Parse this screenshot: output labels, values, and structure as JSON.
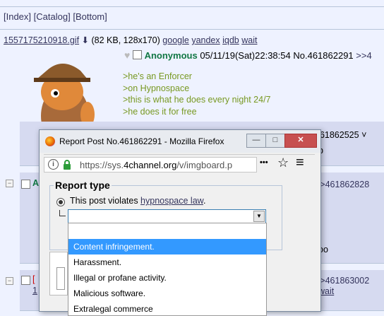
{
  "nav": {
    "index": "[Index]",
    "catalog": "[Catalog]",
    "bottom": "[Bottom]"
  },
  "file": {
    "filename": "1557175210918.gif",
    "meta": "(82 KB, 128x170)",
    "search_links": [
      "google",
      "yandex",
      "iqdb",
      "wait"
    ]
  },
  "post": {
    "name": "Anonymous",
    "datetime": "05/11/19(Sat)22:38:54",
    "number": "No.461862291",
    "arrows": ">>4",
    "lines": [
      ">he's an Enforcer",
      ">on Hypnospace",
      ">this is what he does every night 24/7",
      ">he does it for free"
    ]
  },
  "side": {
    "reply1_no": "461862525",
    "reply1_chev": "˅",
    "reply2_no": ">>461862828",
    "reply2_letter": "A",
    "reply3_no": ">>461863002",
    "reply3_link": "wait",
    "reply3_num": "1",
    "frag_oo": "oo",
    "frag_b": "b",
    "frag_bracket": "["
  },
  "window": {
    "title": "Report Post No.461862291 - Mozilla Firefox",
    "url_prefix": "https://sys.",
    "url_domain": "4channel.org",
    "url_suffix": "/v/imgboard.p",
    "more_icon": "•••",
    "star_icon": "☆",
    "menu_icon": "≡"
  },
  "report": {
    "legend": "Report type",
    "violates_prefix": "This post violates ",
    "violates_link": "hypnospace law",
    "violates_suffix": ".",
    "options": [
      "",
      "Content infringement.",
      "Harassment.",
      "Illegal or profane activity.",
      "Malicious software.",
      "Extralegal commerce"
    ],
    "selected": "Content infringement."
  }
}
